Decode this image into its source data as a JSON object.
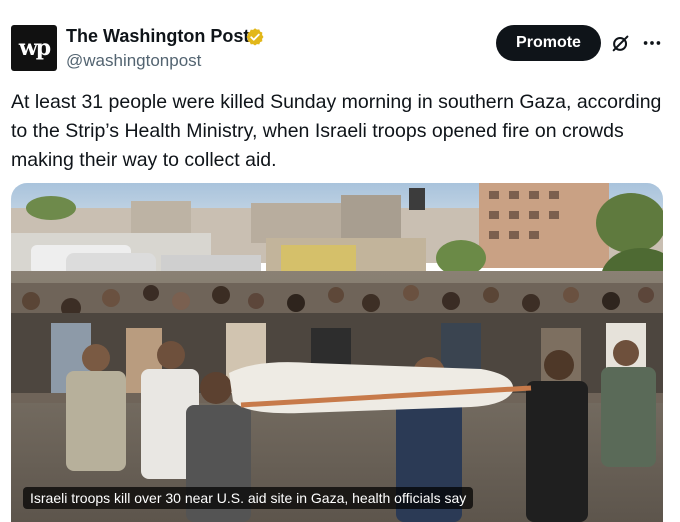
{
  "account": {
    "avatar_text": "wp",
    "display_name": "The Washington Post",
    "handle": "@washingtonpost",
    "verified_badge_color": "#e2b719"
  },
  "actions": {
    "promote_label": "Promote",
    "grok_icon": "grok-icon",
    "more_icon": "more-icon"
  },
  "tweet": {
    "text": "At least 31 people were killed Sunday morning in southern Gaza, according to the Strip’s Health Ministry, when Israeli troops opened fire on crowds making their way to collect aid."
  },
  "media": {
    "caption": "Israeli troops kill over 30 near U.S. aid site in Gaza, health officials say"
  },
  "colors": {
    "text_primary": "#0f1419",
    "text_secondary": "#536471",
    "button_bg": "#0f1419"
  }
}
